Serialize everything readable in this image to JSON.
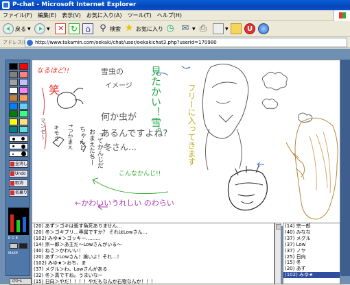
{
  "window": {
    "title": "P-chat - Microsoft Internet Explorer"
  },
  "menu": [
    "ファイル(F)",
    "編集(E)",
    "表示(V)",
    "お気に入り(A)",
    "ツール(T)",
    "ヘルプ(H)"
  ],
  "toolbar": {
    "back_label": "戻る",
    "search_label": "検索",
    "favorites_label": "お気に入り"
  },
  "address": {
    "label": "アドレス(D)",
    "url": "http://www.takamin.com/oekaki/chat/user/oekakichat3.php?userid=170980"
  },
  "palette": {
    "buttons": [
      "全消し",
      "Undo",
      "取消",
      "名乗り"
    ],
    "picker_labels": [
      "R",
      "G",
      "B"
    ],
    "picker_caption": "MAKE",
    "swatches": [
      "#000000",
      "#ff0000",
      "#808080",
      "#ff8080",
      "#a0a0a0",
      "#c0c0ff",
      "#ffffff",
      "#ff80ff",
      "#c08040",
      "#ffa060",
      "#0080ff",
      "#60d0ff",
      "#008000",
      "#40ff80",
      "#ffff00",
      "#ffe080",
      "#008080",
      "#60e0e0"
    ],
    "colors": {
      "accent_blue": "#4f77a8",
      "canvas_bg": "#ffffff"
    },
    "bottom_tab": "ｽｸﾛｰﾙ"
  },
  "canvas": {
    "texts": [
      "なるほど!!",
      "笑",
      "マンセ～",
      "雪虫の",
      "イメージ",
      "見たかい！雪。",
      "フリーに入ってきます",
      "何か虫が",
      "あるんですよね?",
      "冬さん…",
      "こんなかんじ!!",
      "←かわいいうれしい のわらい",
      "キモさ",
      "↑つかまえ",
      "ちゃんと",
      "おまえたちー",
      "ってかんじだ"
    ]
  },
  "chat": {
    "lines": [
      "(20) あず＞ゴキは殺す魚死ありません…",
      "(20) 冬＞ゴキブリ…専属ですか？ それはLowさん…",
      "(102) みゆ★＞ゴッキー………",
      "(14) 宗一郎＞あ主だ～Lowさんがいる～",
      "(40) ねさ＞かわいい！",
      "(20) あず＞Lowさん！挨いよ！それ…！",
      "(102) みゆ★＞おち、ま",
      "(37) メグル＞わ、Lowさんがある",
      "(32) 冬＞真ですね。うまいなー",
      "(15) 日向＞やだ！！！！やだもなんか右物なんか！！！"
    ]
  },
  "users": {
    "items": [
      "(14) 宗一郎",
      "(40) みなな",
      "(37) メグル",
      "(37) Low",
      "(37) ノヤ",
      "(25) 日向",
      "(15) 冬",
      "(20) あず",
      "(102) みゆ★"
    ],
    "selected_index": 8
  }
}
